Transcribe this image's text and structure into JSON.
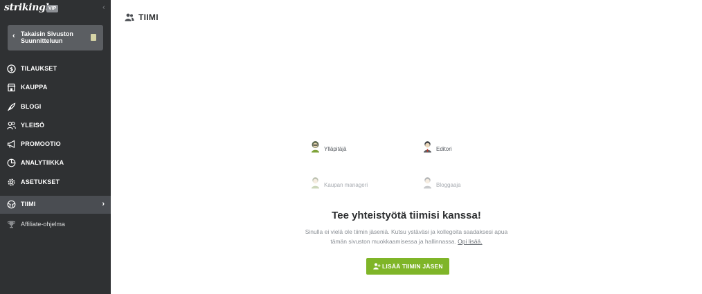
{
  "app": {
    "logo_text": "strikingly",
    "vip_badge": "VIP",
    "accent_color": "#7fb528",
    "sidebar_color": "#2f3133"
  },
  "sidebar": {
    "back_button": {
      "label": "Takaisin Sivuston Suunnitteluun",
      "icon": "chevron-left-icon"
    },
    "items": [
      {
        "label": "TILAUKSET",
        "icon": "dollar-circle-icon"
      },
      {
        "label": "KAUPPA",
        "icon": "store-icon"
      },
      {
        "label": "BLOGI",
        "icon": "quill-icon"
      },
      {
        "label": "YLEISÖ",
        "icon": "people-icon"
      },
      {
        "label": "PROMOOTIO",
        "icon": "megaphone-icon"
      },
      {
        "label": "ANALYTIIKKA",
        "icon": "pie-chart-icon"
      },
      {
        "label": "ASETUKSET",
        "icon": "gear-icon"
      },
      {
        "label": "TIIMI",
        "icon": "team-icon",
        "active": true
      },
      {
        "label": "Affiliate-ohjelma",
        "icon": "trophy-icon"
      }
    ]
  },
  "main": {
    "title": "TIIMI",
    "roles": [
      {
        "label": "Ylläpitäjä",
        "icon": "admin-avatar-icon"
      },
      {
        "label": "Editori",
        "icon": "editor-avatar-icon"
      },
      {
        "label": "Kaupan manageri",
        "icon": "store-manager-avatar-icon"
      },
      {
        "label": "Bloggaaja",
        "icon": "blogger-avatar-icon"
      }
    ],
    "headline": "Tee yhteistyötä tiimisi kanssa!",
    "description_line1": "Sinulla ei vielä ole tiimin jäseniä. Kutsu ystäväsi ja kollegoita saadaksesi apua",
    "description_line2": "tämän sivuston muokkaamisessa ja hallinnassa.",
    "learn_more": "Opi lisää.",
    "add_button": "LISÄÄ TIIMIN JÄSEN"
  }
}
